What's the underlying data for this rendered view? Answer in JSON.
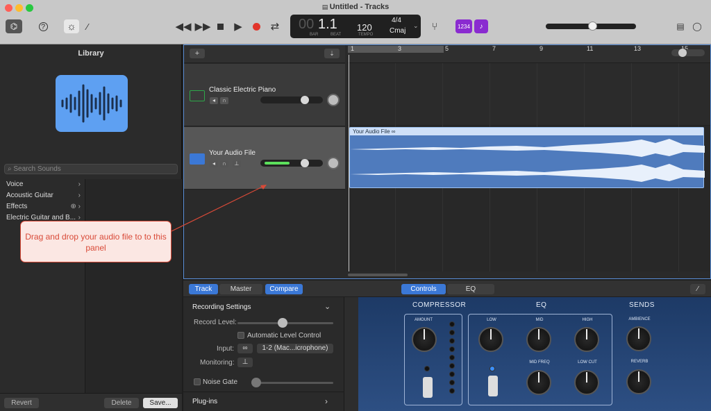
{
  "window": {
    "title": "Untitled - Tracks"
  },
  "toolbar": {
    "lcd": {
      "bar_beat": "1.1",
      "bar_prefix": "00",
      "bar_label": "BAR",
      "beat_label": "BEAT",
      "tempo": "120",
      "tempo_label": "TEMPO",
      "signature": "4/4",
      "key": "Cmaj"
    },
    "count_in_label": "1234",
    "metronome_label": "♪",
    "master_volume": 0.52
  },
  "library": {
    "title": "Library",
    "search_placeholder": "Search Sounds",
    "items": [
      {
        "label": "Voice"
      },
      {
        "label": "Acoustic Guitar"
      },
      {
        "label": "Effects"
      },
      {
        "label": "Electric Guitar and B..."
      }
    ],
    "revert_label": "Revert",
    "delete_label": "Delete",
    "save_label": "Save..."
  },
  "callout": {
    "text": "Drag and drop your audio file to to this panel"
  },
  "tracks": {
    "add_label": "+",
    "items": [
      {
        "name": "Classic Electric Piano",
        "color": "#2ea84a"
      },
      {
        "name": "Your Audio File",
        "color": "#3b78d6"
      }
    ],
    "region_name": "Your Audio File",
    "ruler": [
      "1",
      "3",
      "5",
      "7",
      "9",
      "11",
      "13",
      "15"
    ]
  },
  "editor": {
    "tabs": {
      "track": "Track",
      "master": "Master",
      "compare": "Compare",
      "controls": "Controls",
      "eq": "EQ"
    },
    "recording_settings": "Recording Settings",
    "record_level_label": "Record Level:",
    "alc_label": "Automatic Level Control",
    "input_label": "Input:",
    "input_value": "1-2  (Mac...icrophone)",
    "monitoring_label": "Monitoring:",
    "noise_gate_label": "Noise Gate",
    "plugins_label": "Plug-ins",
    "amp": {
      "compressor": "COMPRESSOR",
      "eq": "EQ",
      "sends": "SENDS",
      "amount": "AMOUNT",
      "low": "LOW",
      "mid": "MID",
      "high": "HIGH",
      "mid_freq": "MID FREQ",
      "low_cut": "LOW CUT",
      "ambience": "AMBIENCE",
      "reverb": "REVERB"
    }
  }
}
